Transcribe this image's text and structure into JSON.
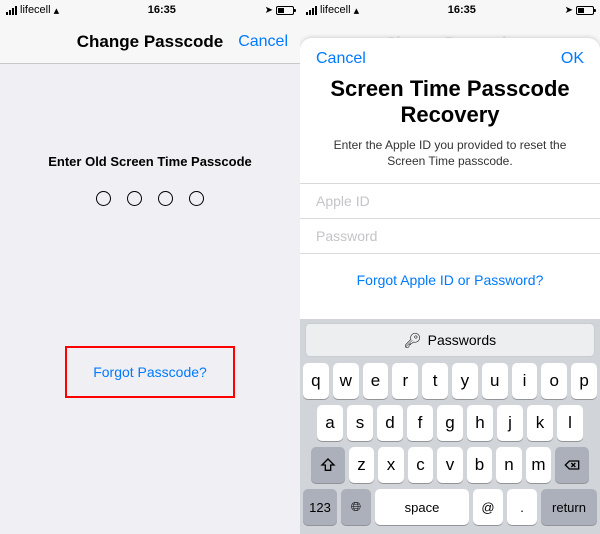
{
  "status": {
    "carrier": "lifecell",
    "time": "16:35"
  },
  "left": {
    "title": "Change Passcode",
    "cancel": "Cancel",
    "prompt": "Enter Old Screen Time Passcode",
    "forgot": "Forgot Passcode?"
  },
  "right": {
    "navTitleHidden": "Change Passcode",
    "modal": {
      "cancel": "Cancel",
      "ok": "OK",
      "title": "Screen Time Passcode Recovery",
      "subtitle": "Enter the Apple ID you provided to reset the Screen Time passcode.",
      "appleIdPlaceholder": "Apple ID",
      "passwordPlaceholder": "Password",
      "forgotLink": "Forgot Apple ID or Password?"
    }
  },
  "keyboard": {
    "passwordsBar": "Passwords",
    "row1": [
      "q",
      "w",
      "e",
      "r",
      "t",
      "y",
      "u",
      "i",
      "o",
      "p"
    ],
    "row2": [
      "a",
      "s",
      "d",
      "f",
      "g",
      "h",
      "j",
      "k",
      "l"
    ],
    "row3": [
      "z",
      "x",
      "c",
      "v",
      "b",
      "n",
      "m"
    ],
    "numKey": "123",
    "space": "space",
    "at": "@",
    "dot": ".",
    "return": "return"
  }
}
